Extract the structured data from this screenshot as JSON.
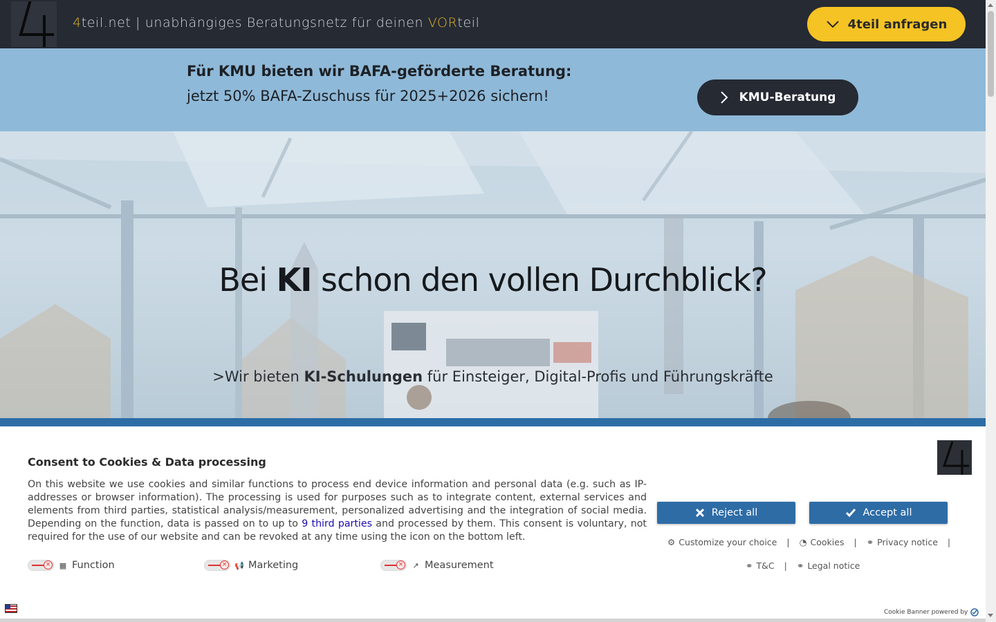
{
  "header": {
    "logo_text": "4",
    "tagline_prefix": "4",
    "tagline_mid": "teil.net | unabhängiges Beratungsnetz für deinen ",
    "tagline_accent": "VOR",
    "tagline_suffix": "teil",
    "cta_label": "4teil anfragen"
  },
  "bafa": {
    "line1": "Für KMU bieten wir BAFA-geförderte Beratung:",
    "line2": "jetzt 50% BAFA-Zuschuss für 2025+2026 sichern!",
    "button_label": "KMU-Beratung"
  },
  "hero": {
    "title_pre": "Bei ",
    "title_bold": "KI",
    "title_post": " schon den vollen Durchblick?",
    "sub_pre": ">Wir bieten ",
    "sub_bold": "KI-Schulungen",
    "sub_post": " für Einsteiger, Digital-Profis und Führungskräfte"
  },
  "cookie": {
    "logo_text": "4",
    "title": "Consent to Cookies & Data processing",
    "text_pre": "On this website we use cookies and similar functions to process end device information and personal data (e.g. such as IP-addresses or browser information). The processing is used for purposes such as to integrate content, external services and elements from third parties, statistical analysis/measurement, personalized advertising and the integration of social media. Depending on the function, data is passed on to up to ",
    "third_parties_link": "9 third parties",
    "text_post": " and processed by them. This consent is voluntary, not required for the use of our website and can be revoked at any time using the icon on the bottom left.",
    "reject_label": "Reject all",
    "accept_label": "Accept all",
    "links": {
      "customize": "Customize your choice",
      "cookies": "Cookies",
      "privacy": "Privacy notice",
      "tc": "T&C",
      "legal": "Legal notice"
    },
    "toggles": [
      {
        "label": "Function",
        "icon": "function-grid-icon",
        "enabled": false
      },
      {
        "label": "Marketing",
        "icon": "megaphone-icon",
        "enabled": false
      },
      {
        "label": "Measurement",
        "icon": "chart-line-icon",
        "enabled": false
      }
    ],
    "powered_by": "Cookie Banner powered by"
  },
  "colors": {
    "header_bg": "#252a33",
    "accent_yellow": "#f5c324",
    "bafa_bg": "#8fb9d8",
    "cookie_button_blue": "#2e6ca6",
    "strip_blue": "#2d6da6"
  }
}
